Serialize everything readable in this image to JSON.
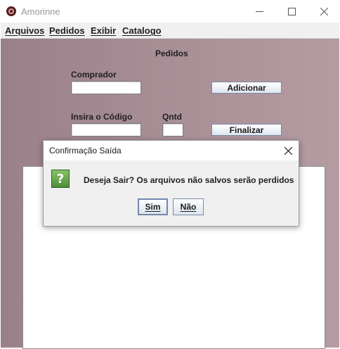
{
  "window": {
    "title": "Amorinne",
    "controls": {
      "minimize": "—",
      "maximize": "☐",
      "close": "✕"
    }
  },
  "menubar": {
    "items": [
      {
        "label": "Arquivos"
      },
      {
        "label": "Pedidos"
      },
      {
        "label": "Exibir"
      },
      {
        "label": "Catalogo"
      }
    ]
  },
  "form": {
    "heading": "Pedidos",
    "buyer_label": "Comprador",
    "buyer_value": "",
    "add_button": "Adicionar",
    "code_label": "Insira o Código",
    "code_value": "",
    "qty_label": "Qntd",
    "qty_value": "",
    "finish_button": "Finalizar",
    "text_area_value": ""
  },
  "dialog": {
    "title": "Confirmação Saída",
    "icon": "question-icon",
    "icon_glyph": "?",
    "message": "Deseja Sair? Os arquivos não salvos serão perdidos",
    "yes_button": "Sim",
    "no_button": "Não"
  },
  "colors": {
    "content_background": "#a88f96",
    "question_icon": "#5a9a42"
  }
}
